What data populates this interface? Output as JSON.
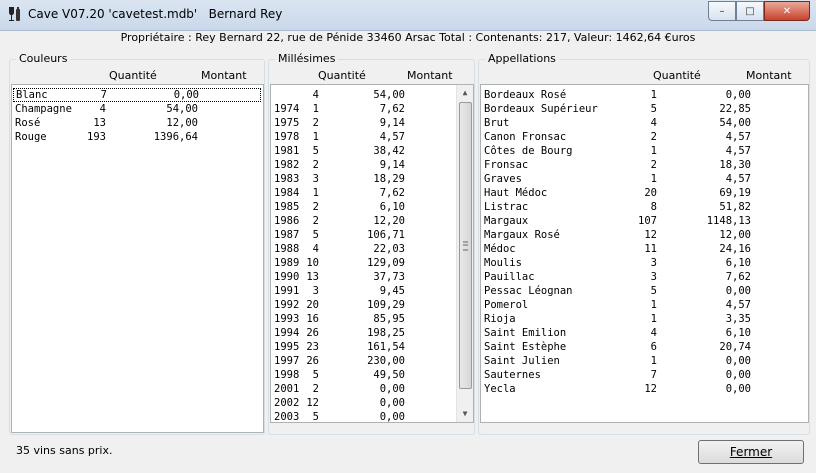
{
  "window": {
    "title": "Cave V07.20 'cavetest.mdb'   Bernard Rey",
    "minimize_glyph": "–",
    "maximize_glyph": "□",
    "close_glyph": "✕"
  },
  "owner_line": "Propriétaire : Rey Bernard 22, rue de Pénide 33460 Arsac Total : Contenants: 217, Valeur: 1462,64 €uros",
  "couleurs": {
    "label": "Couleurs",
    "col_quantite": "Quantité",
    "col_montant": "Montant",
    "rows": [
      {
        "name": "Blanc",
        "qty": "7",
        "amount": "0,00"
      },
      {
        "name": "Champagne",
        "qty": "4",
        "amount": "54,00"
      },
      {
        "name": "Rosé",
        "qty": "13",
        "amount": "12,00"
      },
      {
        "name": "Rouge",
        "qty": "193",
        "amount": "1396,64"
      }
    ]
  },
  "millesimes": {
    "label": "Millésimes",
    "col_quantite": "Quantité",
    "col_montant": "Montant",
    "rows": [
      {
        "name": "",
        "qty": "4",
        "amount": "54,00"
      },
      {
        "name": "1974",
        "qty": "1",
        "amount": "7,62"
      },
      {
        "name": "1975",
        "qty": "2",
        "amount": "9,14"
      },
      {
        "name": "1978",
        "qty": "1",
        "amount": "4,57"
      },
      {
        "name": "1981",
        "qty": "5",
        "amount": "38,42"
      },
      {
        "name": "1982",
        "qty": "2",
        "amount": "9,14"
      },
      {
        "name": "1983",
        "qty": "3",
        "amount": "18,29"
      },
      {
        "name": "1984",
        "qty": "1",
        "amount": "7,62"
      },
      {
        "name": "1985",
        "qty": "2",
        "amount": "6,10"
      },
      {
        "name": "1986",
        "qty": "2",
        "amount": "12,20"
      },
      {
        "name": "1987",
        "qty": "5",
        "amount": "106,71"
      },
      {
        "name": "1988",
        "qty": "4",
        "amount": "22,03"
      },
      {
        "name": "1989",
        "qty": "10",
        "amount": "129,09"
      },
      {
        "name": "1990",
        "qty": "13",
        "amount": "37,73"
      },
      {
        "name": "1991",
        "qty": "3",
        "amount": "9,45"
      },
      {
        "name": "1992",
        "qty": "20",
        "amount": "109,29"
      },
      {
        "name": "1993",
        "qty": "16",
        "amount": "85,95"
      },
      {
        "name": "1994",
        "qty": "26",
        "amount": "198,25"
      },
      {
        "name": "1995",
        "qty": "23",
        "amount": "161,54"
      },
      {
        "name": "1997",
        "qty": "26",
        "amount": "230,00"
      },
      {
        "name": "1998",
        "qty": "5",
        "amount": "49,50"
      },
      {
        "name": "2001",
        "qty": "2",
        "amount": "0,00"
      },
      {
        "name": "2002",
        "qty": "12",
        "amount": "0,00"
      },
      {
        "name": "2003",
        "qty": "5",
        "amount": "0,00"
      }
    ]
  },
  "appellations": {
    "label": "Appellations",
    "col_quantite": "Quantité",
    "col_montant": "Montant",
    "rows": [
      {
        "name": "Bordeaux Rosé",
        "qty": "1",
        "amount": "0,00"
      },
      {
        "name": "Bordeaux Supérieur",
        "qty": "5",
        "amount": "22,85"
      },
      {
        "name": "Brut",
        "qty": "4",
        "amount": "54,00"
      },
      {
        "name": "Canon Fronsac",
        "qty": "2",
        "amount": "4,57"
      },
      {
        "name": "Côtes de Bourg",
        "qty": "1",
        "amount": "4,57"
      },
      {
        "name": "Fronsac",
        "qty": "2",
        "amount": "18,30"
      },
      {
        "name": "Graves",
        "qty": "1",
        "amount": "4,57"
      },
      {
        "name": "Haut Médoc",
        "qty": "20",
        "amount": "69,19"
      },
      {
        "name": "Listrac",
        "qty": "8",
        "amount": "51,82"
      },
      {
        "name": "Margaux",
        "qty": "107",
        "amount": "1148,13"
      },
      {
        "name": "Margaux Rosé",
        "qty": "12",
        "amount": "12,00"
      },
      {
        "name": "Médoc",
        "qty": "11",
        "amount": "24,16"
      },
      {
        "name": "Moulis",
        "qty": "3",
        "amount": "6,10"
      },
      {
        "name": "Pauillac",
        "qty": "3",
        "amount": "7,62"
      },
      {
        "name": "Pessac Léognan",
        "qty": "5",
        "amount": "0,00"
      },
      {
        "name": "Pomerol",
        "qty": "1",
        "amount": "4,57"
      },
      {
        "name": "Rioja",
        "qty": "1",
        "amount": "3,35"
      },
      {
        "name": "Saint Emilion",
        "qty": "4",
        "amount": "6,10"
      },
      {
        "name": "Saint Estèphe",
        "qty": "6",
        "amount": "20,74"
      },
      {
        "name": "Saint Julien",
        "qty": "1",
        "amount": "0,00"
      },
      {
        "name": "Sauternes",
        "qty": "7",
        "amount": "0,00"
      },
      {
        "name": "Yecla",
        "qty": "12",
        "amount": "0,00"
      }
    ]
  },
  "status_text": "35 vins sans prix.",
  "close_button_label": "Fermer",
  "scrollbar": {
    "up_glyph": "▲",
    "down_glyph": "▼"
  }
}
